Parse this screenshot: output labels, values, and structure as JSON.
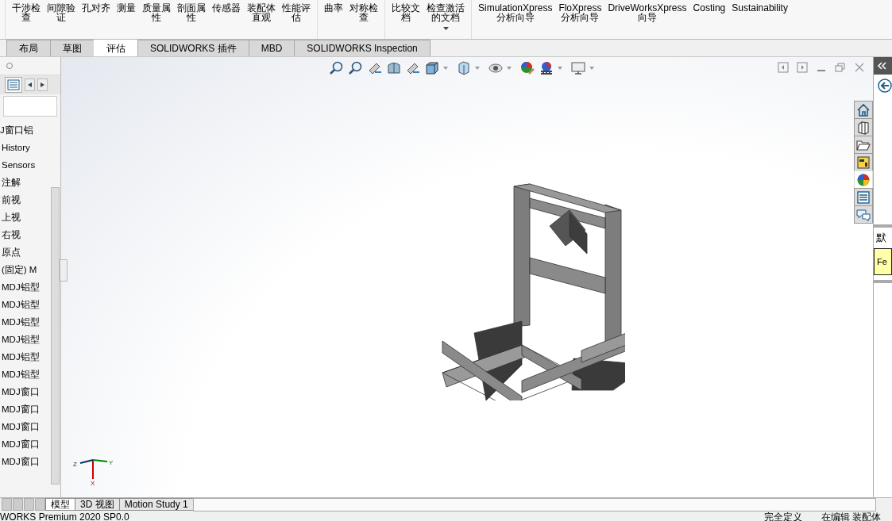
{
  "ribbon": {
    "groups": [
      {
        "items": [
          {
            "label": "干涉检查"
          },
          {
            "label": "间隙验证"
          },
          {
            "label": "孔对齐"
          },
          {
            "label": "测量"
          },
          {
            "label": "质量属性"
          },
          {
            "label": "剖面属性"
          },
          {
            "label": "传感器"
          },
          {
            "label": "装配体直观"
          },
          {
            "label": "性能评估"
          }
        ]
      },
      {
        "items": [
          {
            "label": "曲率"
          },
          {
            "label": "对称检查"
          }
        ]
      },
      {
        "items": [
          {
            "label": "比较文档"
          },
          {
            "label": "检查激活的文档",
            "dropdown": true
          }
        ]
      },
      {
        "items": [
          {
            "label": "SimulationXpress 分析向导"
          },
          {
            "label": "FloXpress 分析向导"
          },
          {
            "label": "DriveWorksXpress 向导"
          },
          {
            "label": "Costing"
          },
          {
            "label": "Sustainability"
          }
        ]
      }
    ]
  },
  "tabs": [
    {
      "label": "布局",
      "selected": false
    },
    {
      "label": "草图",
      "selected": false
    },
    {
      "label": "评估",
      "selected": true
    },
    {
      "label": "SOLIDWORKS 插件",
      "selected": false
    },
    {
      "label": "MBD",
      "selected": false
    },
    {
      "label": "SOLIDWORKS Inspection",
      "selected": false
    }
  ],
  "feature_tree": {
    "root": "J窗口铝",
    "items": [
      "History",
      "Sensors",
      "注解",
      "前视",
      "上视",
      "右视",
      "原点",
      "(固定) M",
      "MDJ铝型",
      "MDJ铝型",
      "MDJ铝型",
      "MDJ铝型",
      "MDJ铝型",
      "MDJ铝型",
      "MDJ窗口",
      "MDJ窗口",
      "MDJ窗口",
      "MDJ窗口",
      "MDJ窗口"
    ]
  },
  "viewport": {
    "triad": {
      "x": "X",
      "y": "Y",
      "z": "Z"
    }
  },
  "task_pane": {
    "tabs": [
      {
        "kind": "home",
        "selected": false
      },
      {
        "kind": "parts",
        "selected": false
      },
      {
        "kind": "folder",
        "selected": false
      },
      {
        "kind": "palette",
        "selected": false
      },
      {
        "kind": "appearance",
        "selected": true
      },
      {
        "kind": "properties",
        "selected": false
      },
      {
        "kind": "forum",
        "selected": false
      }
    ],
    "heading": "默",
    "note": "Fe"
  },
  "bottom_tabs": [
    {
      "label": "模型",
      "selected": true
    },
    {
      "label": "3D 视图",
      "selected": false
    },
    {
      "label": "Motion Study 1",
      "selected": false
    }
  ],
  "status_bar": {
    "product": "WORKS Premium 2020 SP0.0",
    "state": "完全定义",
    "mode": "在编辑 装配体"
  }
}
